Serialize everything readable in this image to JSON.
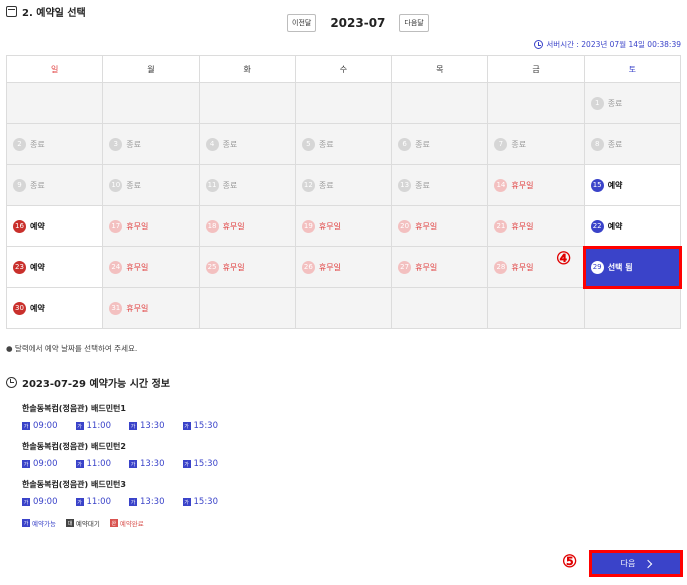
{
  "section": {
    "title": "2. 예약일 선택"
  },
  "nav": {
    "prev_label": "이전달",
    "month": "2023-07",
    "next_label": "다음달"
  },
  "server_time": "서버시간 : 2023년 07월 14일 00:38:39",
  "weekdays": [
    "일",
    "월",
    "화",
    "수",
    "목",
    "금",
    "토"
  ],
  "calendar_rows": [
    [
      {
        "day": "",
        "status": "",
        "kind": "empty"
      },
      {
        "day": "",
        "status": "",
        "kind": "empty"
      },
      {
        "day": "",
        "status": "",
        "kind": "empty"
      },
      {
        "day": "",
        "status": "",
        "kind": "empty"
      },
      {
        "day": "",
        "status": "",
        "kind": "empty"
      },
      {
        "day": "",
        "status": "",
        "kind": "empty"
      },
      {
        "day": "1",
        "status": "종료",
        "kind": "closed"
      }
    ],
    [
      {
        "day": "2",
        "status": "종료",
        "kind": "closed"
      },
      {
        "day": "3",
        "status": "종료",
        "kind": "closed"
      },
      {
        "day": "4",
        "status": "종료",
        "kind": "closed"
      },
      {
        "day": "5",
        "status": "종료",
        "kind": "closed"
      },
      {
        "day": "6",
        "status": "종료",
        "kind": "closed"
      },
      {
        "day": "7",
        "status": "종료",
        "kind": "closed"
      },
      {
        "day": "8",
        "status": "종료",
        "kind": "closed"
      }
    ],
    [
      {
        "day": "9",
        "status": "종료",
        "kind": "closed"
      },
      {
        "day": "10",
        "status": "종료",
        "kind": "closed"
      },
      {
        "day": "11",
        "status": "종료",
        "kind": "closed"
      },
      {
        "day": "12",
        "status": "종료",
        "kind": "closed"
      },
      {
        "day": "13",
        "status": "종료",
        "kind": "closed"
      },
      {
        "day": "14",
        "status": "휴무일",
        "kind": "holiday"
      },
      {
        "day": "15",
        "status": "예약",
        "kind": "open-sat"
      }
    ],
    [
      {
        "day": "16",
        "status": "예약",
        "kind": "open-sun"
      },
      {
        "day": "17",
        "status": "휴무일",
        "kind": "holiday"
      },
      {
        "day": "18",
        "status": "휴무일",
        "kind": "holiday"
      },
      {
        "day": "19",
        "status": "휴무일",
        "kind": "holiday"
      },
      {
        "day": "20",
        "status": "휴무일",
        "kind": "holiday"
      },
      {
        "day": "21",
        "status": "휴무일",
        "kind": "holiday"
      },
      {
        "day": "22",
        "status": "예약",
        "kind": "open-sat"
      }
    ],
    [
      {
        "day": "23",
        "status": "예약",
        "kind": "open-sun"
      },
      {
        "day": "24",
        "status": "휴무일",
        "kind": "holiday"
      },
      {
        "day": "25",
        "status": "휴무일",
        "kind": "holiday"
      },
      {
        "day": "26",
        "status": "휴무일",
        "kind": "holiday"
      },
      {
        "day": "27",
        "status": "휴무일",
        "kind": "holiday"
      },
      {
        "day": "28",
        "status": "휴무일",
        "kind": "holiday"
      },
      {
        "day": "29",
        "status": "선택 됨",
        "kind": "selected"
      }
    ],
    [
      {
        "day": "30",
        "status": "예약",
        "kind": "open-sun"
      },
      {
        "day": "31",
        "status": "휴무일",
        "kind": "holiday"
      },
      {
        "day": "",
        "status": "",
        "kind": "empty"
      },
      {
        "day": "",
        "status": "",
        "kind": "empty"
      },
      {
        "day": "",
        "status": "",
        "kind": "empty"
      },
      {
        "day": "",
        "status": "",
        "kind": "empty"
      },
      {
        "day": "",
        "status": "",
        "kind": "empty"
      }
    ]
  ],
  "annotations": {
    "step4": "④",
    "step5": "⑤"
  },
  "note": "● 달력에서 예약 날짜를 선택하여 주세요.",
  "time_info": {
    "title": "2023-07-29 예약가능 시간 정보",
    "badge_avail": "가",
    "courts": [
      {
        "name": "한솔동복컴(정음관) 배드민턴1",
        "slots": [
          "09:00",
          "11:00",
          "13:30",
          "15:30"
        ]
      },
      {
        "name": "한솔동복컴(정음관) 배드민턴2",
        "slots": [
          "09:00",
          "11:00",
          "13:30",
          "15:30"
        ]
      },
      {
        "name": "한솔동복컴(정음관) 배드민턴3",
        "slots": [
          "09:00",
          "11:00",
          "13:30",
          "15:30"
        ]
      }
    ]
  },
  "legend": {
    "avail_badge": "가",
    "avail_label": "예약가능",
    "wait_badge": "대",
    "wait_label": "예약대기",
    "done_badge": "완",
    "done_label": "예약완료"
  },
  "next_button": {
    "label": "다음"
  },
  "colors": {
    "accent": "#3a43c9",
    "holiday": "#e03b3b",
    "highlight": "#ff0000"
  }
}
